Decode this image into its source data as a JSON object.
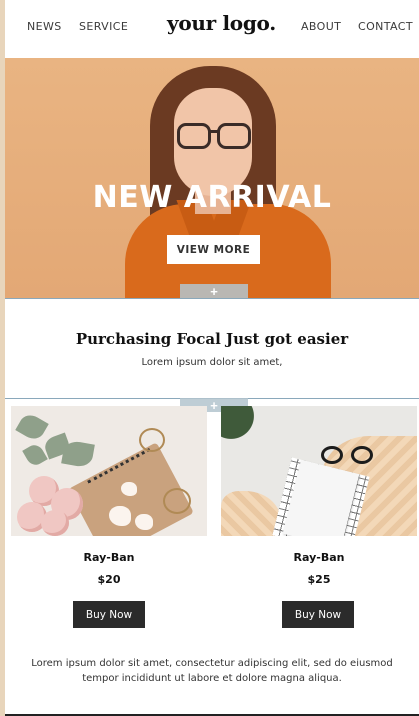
{
  "header": {
    "nav_left": [
      "NEWS",
      "SERVICE"
    ],
    "logo": "your logo.",
    "nav_right": [
      "ABOUT",
      "CONTACT"
    ]
  },
  "hero": {
    "title": "NEW ARRIVAL",
    "button_label": "VIEW MORE",
    "plus_icon": "+"
  },
  "intro": {
    "title": "Purchasing Focal Just got easier",
    "subtitle": "Lorem ipsum dolor sit amet,"
  },
  "products_section": {
    "plus_icon": "+"
  },
  "products": [
    {
      "name": "Ray-Ban",
      "price": "$20",
      "button_label": "Buy Now"
    },
    {
      "name": "Ray-Ban",
      "price": "$25",
      "button_label": "Buy Now"
    }
  ],
  "footer": {
    "text": "Lorem ipsum dolor sit amet, consectetur adipiscing elit, sed do eiusmod tempor incididunt ut labore et dolore magna aliqua."
  },
  "colors": {
    "hero_bg": "#e5ad7a",
    "button_dark": "#2b2b2b",
    "side_strip": "#e8d5bb",
    "divider": "#8aa8bb"
  }
}
